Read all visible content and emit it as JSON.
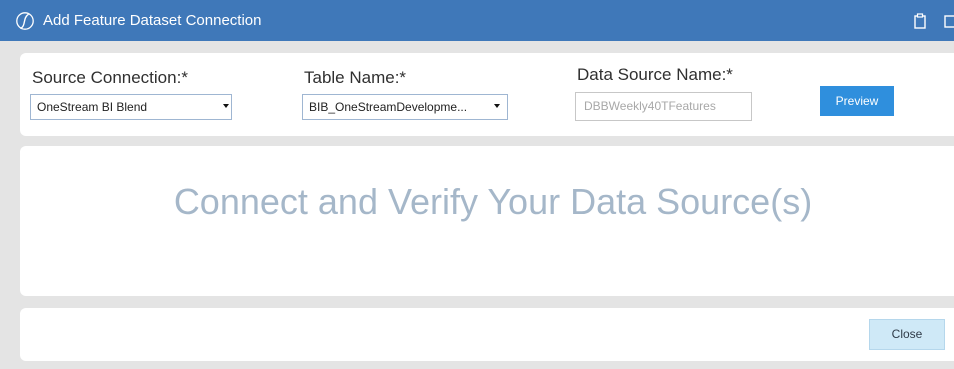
{
  "window": {
    "title": "Add Feature Dataset Connection",
    "logo_icon": "onestream-logo-icon",
    "titlebar_icons": [
      "clipboard-icon",
      "window-icon"
    ],
    "colors": {
      "titlebar": "#3f78b9",
      "background": "#e4e4e4",
      "primary_button": "#2f8fdd",
      "secondary_button": "#cfe9f7",
      "headline_text": "#a5b7c9"
    }
  },
  "form": {
    "source_connection": {
      "label": "Source Connection:*",
      "selected": "OneStream BI Blend"
    },
    "table_name": {
      "label": "Table Name:*",
      "selected": "BIB_OneStreamDevelopme..."
    },
    "data_source_name": {
      "label": "Data Source Name:*",
      "placeholder": "DBBWeekly40TFeatures"
    },
    "preview_label": "Preview"
  },
  "main": {
    "headline": "Connect and Verify Your Data Source(s)"
  },
  "footer": {
    "close_label": "Close"
  }
}
